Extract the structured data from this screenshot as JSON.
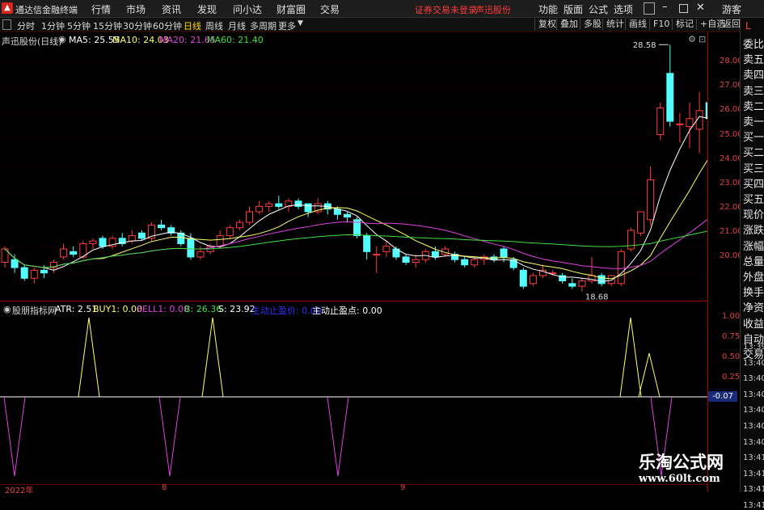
{
  "app": {
    "title": "通达信金融终端",
    "menu": [
      "行情",
      "市场",
      "资讯",
      "发现",
      "问小达",
      "财富圈",
      "交易"
    ],
    "alert": "证券交易未登录",
    "stock_alert": "声迅股份",
    "menu_right": [
      "功能",
      "版面",
      "公式",
      "选项"
    ],
    "user": "游客"
  },
  "periods": [
    "分时",
    "1分钟",
    "5分钟",
    "15分钟",
    "30分钟",
    "60分钟",
    "日线",
    "周线",
    "月线",
    "多周期",
    "更多"
  ],
  "active_period": "日线",
  "toolbar": [
    "复权",
    "叠加",
    "多股",
    "统计",
    "画线",
    "F10",
    "标记",
    "+自选",
    "返回"
  ],
  "main": {
    "stock": "声迅股份(日线)",
    "ma": [
      {
        "label": "MA5: 25.55",
        "color": "#ffffff"
      },
      {
        "label": "MA10: 24.03",
        "color": "#ffff66"
      },
      {
        "label": "MA20: 21.65",
        "color": "#e040e0"
      },
      {
        "label": "MA60: 21.40",
        "color": "#40e040"
      }
    ],
    "high_label": "28.58",
    "low_label": "18.68"
  },
  "indicator": {
    "name": "股朋指标网",
    "items": [
      {
        "label": "ATR: 2.51",
        "color": "#ffffff"
      },
      {
        "label": "BUY1: 0.00",
        "color": "#ffff66"
      },
      {
        "label": "SELL1: 0.00",
        "color": "#e040e0"
      },
      {
        "label": "B: 26.36",
        "color": "#40e040"
      },
      {
        "label": "S: 23.92",
        "color": "#ffffff"
      },
      {
        "label": "主动止盈价: 0.00",
        "color": "#3030ff"
      },
      {
        "label": "主动止盈点: 0.00",
        "color": "#ffffff"
      }
    ],
    "current_value": "-0.07"
  },
  "axis": {
    "price_ticks": [
      "28.00",
      "27.00",
      "26.00",
      "25.00",
      "24.00",
      "23.00",
      "22.00",
      "21.00",
      "20.00"
    ],
    "ind_ticks": [
      "1.00",
      "0.75",
      "0.50",
      "0.25"
    ]
  },
  "right_panel": {
    "labels": [
      "L",
      "委比",
      "卖五",
      "卖四",
      "卖三",
      "卖二",
      "卖一",
      "买一",
      "买二",
      "买三",
      "买四",
      "买五",
      "现价",
      "涨跌",
      "涨幅",
      "总量",
      "外盘",
      "换手",
      "净资",
      "收益",
      "自动",
      "交易"
    ],
    "times": [
      "13:39",
      "13:40",
      "13:40",
      "13:40",
      "13:40",
      "13:40",
      "13:40",
      "13:41",
      "13:41",
      "13:41",
      "13:41"
    ]
  },
  "dates": [
    "2022年",
    "8",
    "9"
  ],
  "watermark": {
    "title": "乐淘公式网",
    "url": "www.60lt.com"
  },
  "chart_data": {
    "type": "candlestick",
    "y_range": [
      19.2,
      28.8
    ],
    "candles": [
      [
        20.4,
        20.9,
        21.0,
        20.2
      ],
      [
        20.5,
        20.2,
        20.7,
        20.0
      ],
      [
        20.2,
        19.8,
        20.3,
        19.7
      ],
      [
        19.8,
        20.1,
        20.2,
        19.6
      ],
      [
        20.1,
        20.0,
        20.3,
        19.8
      ],
      [
        20.2,
        20.4,
        20.5,
        20.0
      ],
      [
        20.6,
        20.9,
        21.1,
        20.5
      ],
      [
        20.8,
        20.7,
        21.0,
        20.6
      ],
      [
        20.6,
        21.1,
        21.2,
        20.5
      ],
      [
        21.1,
        21.2,
        21.3,
        20.9
      ],
      [
        21.3,
        21.0,
        21.4,
        20.9
      ],
      [
        21.0,
        21.3,
        21.4,
        20.9
      ],
      [
        21.3,
        21.1,
        21.5,
        21.0
      ],
      [
        21.2,
        21.4,
        21.6,
        21.1
      ],
      [
        21.5,
        21.3,
        21.6,
        21.2
      ],
      [
        21.3,
        21.8,
        21.9,
        21.2
      ],
      [
        21.8,
        21.7,
        22.0,
        21.6
      ],
      [
        21.7,
        21.5,
        21.8,
        21.4
      ],
      [
        21.5,
        21.1,
        21.6,
        21.0
      ],
      [
        21.3,
        20.6,
        21.5,
        20.5
      ],
      [
        20.6,
        20.8,
        21.0,
        20.5
      ],
      [
        20.8,
        21.0,
        21.1,
        20.7
      ],
      [
        21.0,
        21.4,
        21.6,
        20.9
      ],
      [
        21.4,
        21.7,
        21.8,
        21.3
      ],
      [
        21.7,
        21.9,
        22.0,
        21.6
      ],
      [
        21.9,
        22.3,
        22.5,
        21.8
      ],
      [
        22.3,
        22.5,
        22.7,
        22.2
      ],
      [
        22.5,
        22.6,
        22.7,
        22.3
      ],
      [
        22.6,
        22.5,
        22.9,
        22.4
      ],
      [
        22.5,
        22.7,
        22.8,
        22.3
      ],
      [
        22.7,
        22.5,
        22.8,
        22.4
      ],
      [
        22.6,
        22.3,
        22.6,
        22.1
      ],
      [
        22.3,
        22.6,
        22.8,
        22.2
      ],
      [
        22.6,
        22.4,
        22.7,
        22.2
      ],
      [
        22.4,
        22.2,
        22.5,
        22.0
      ],
      [
        22.2,
        22.1,
        22.3,
        21.9
      ],
      [
        22.0,
        21.4,
        22.1,
        21.3
      ],
      [
        21.4,
        20.8,
        21.5,
        20.5
      ],
      [
        20.7,
        20.7,
        21.0,
        20.0
      ],
      [
        20.8,
        21.0,
        21.2,
        20.6
      ],
      [
        20.9,
        20.6,
        21.0,
        20.5
      ],
      [
        20.6,
        20.4,
        20.7,
        20.3
      ],
      [
        20.4,
        20.5,
        20.7,
        20.2
      ],
      [
        20.5,
        20.8,
        20.9,
        20.4
      ],
      [
        20.8,
        20.6,
        21.0,
        20.5
      ],
      [
        20.7,
        20.9,
        21.0,
        20.6
      ],
      [
        20.7,
        20.5,
        20.8,
        20.4
      ],
      [
        20.5,
        20.3,
        20.6,
        20.2
      ],
      [
        20.3,
        20.5,
        20.6,
        20.2
      ],
      [
        20.5,
        20.6,
        20.7,
        20.3
      ],
      [
        20.6,
        20.5,
        20.7,
        20.4
      ],
      [
        20.9,
        20.6,
        21.0,
        20.4
      ],
      [
        20.5,
        20.2,
        20.6,
        20.1
      ],
      [
        20.1,
        19.5,
        20.2,
        19.4
      ],
      [
        19.6,
        19.9,
        20.0,
        19.5
      ],
      [
        19.9,
        20.1,
        20.3,
        19.8
      ],
      [
        20.0,
        20.0,
        20.1,
        19.9
      ],
      [
        19.9,
        19.7,
        20.0,
        19.6
      ],
      [
        19.6,
        19.5,
        19.8,
        19.4
      ],
      [
        19.5,
        19.7,
        19.8,
        19.3
      ],
      [
        19.7,
        19.9,
        20.6,
        19.6
      ],
      [
        19.9,
        19.6,
        20.0,
        19.5
      ],
      [
        19.6,
        19.9,
        19.9,
        19.5
      ],
      [
        19.6,
        20.8,
        20.9,
        19.5
      ],
      [
        20.9,
        21.6,
        21.7,
        20.8
      ],
      [
        21.5,
        22.3,
        22.3,
        21.4
      ],
      [
        22.0,
        23.5,
        24.0,
        21.8
      ],
      [
        25.2,
        26.2,
        26.4,
        25.0
      ],
      [
        27.5,
        25.7,
        28.58,
        25.5
      ],
      [
        25.6,
        25.6,
        26.0,
        24.9
      ],
      [
        25.5,
        25.8,
        26.4,
        24.7
      ],
      [
        25.4,
        26.1,
        26.8,
        24.5
      ],
      [
        26.4,
        25.8,
        26.7,
        24.0
      ],
      [
        25.5,
        26.1,
        27.1,
        25.3
      ]
    ]
  }
}
